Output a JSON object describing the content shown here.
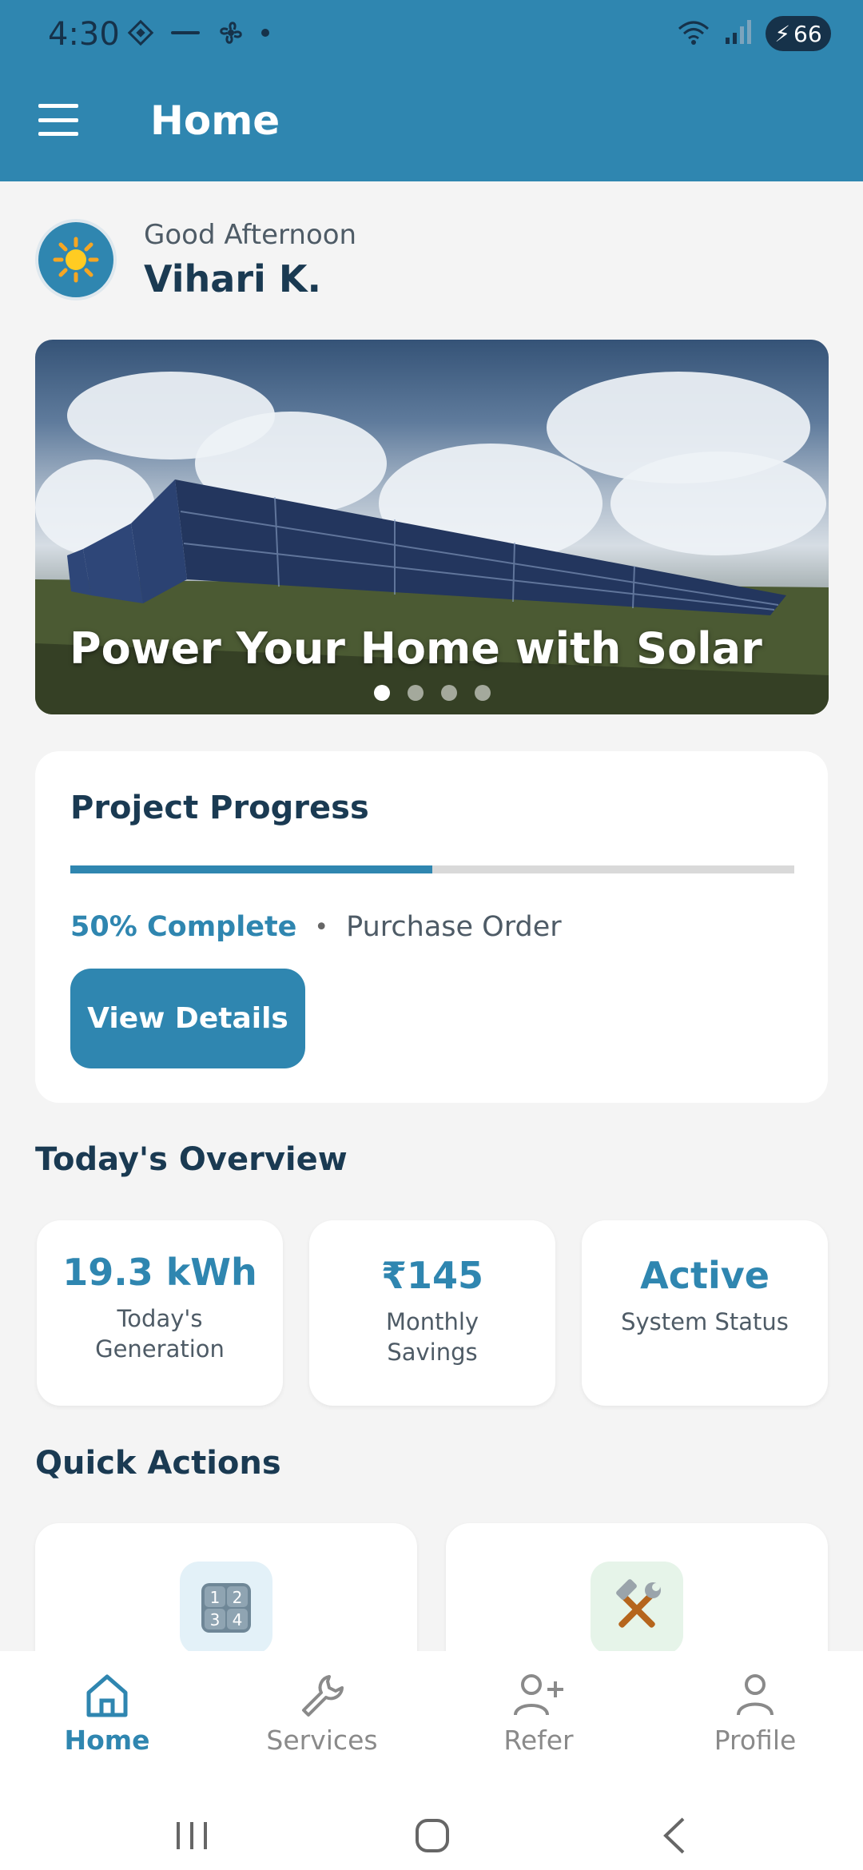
{
  "status_bar": {
    "time": "4:30",
    "battery": "66"
  },
  "app_bar": {
    "title": "Home"
  },
  "greeting": {
    "subtitle": "Good Afternoon",
    "name": "Vihari K."
  },
  "banner": {
    "title": "Power Your Home with Solar",
    "slide_count": 4,
    "active_slide": 1
  },
  "progress": {
    "title": "Project Progress",
    "percent": 50,
    "percent_label": "50% Complete",
    "separator": "•",
    "stage": "Purchase Order",
    "button_label": "View Details"
  },
  "overview": {
    "title": "Today's Overview",
    "cards": [
      {
        "value": "19.3 kWh",
        "label": "Today's Generation"
      },
      {
        "value": "₹145",
        "label": "Monthly Savings"
      },
      {
        "value": "Active",
        "label": "System Status"
      }
    ]
  },
  "quick_actions": {
    "title": "Quick Actions",
    "items": [
      {
        "icon": "calculator-icon",
        "emoji": "🔢"
      },
      {
        "icon": "tools-icon",
        "emoji": "🛠️"
      }
    ]
  },
  "bottom_nav": {
    "items": [
      {
        "label": "Home",
        "icon": "home-icon"
      },
      {
        "label": "Services",
        "icon": "wrench-icon"
      },
      {
        "label": "Refer",
        "icon": "add-person-icon"
      },
      {
        "label": "Profile",
        "icon": "person-icon"
      }
    ]
  },
  "colors": {
    "primary": "#2f86b0",
    "text_dark": "#1a3a52",
    "inactive": "#8a8a8a"
  }
}
